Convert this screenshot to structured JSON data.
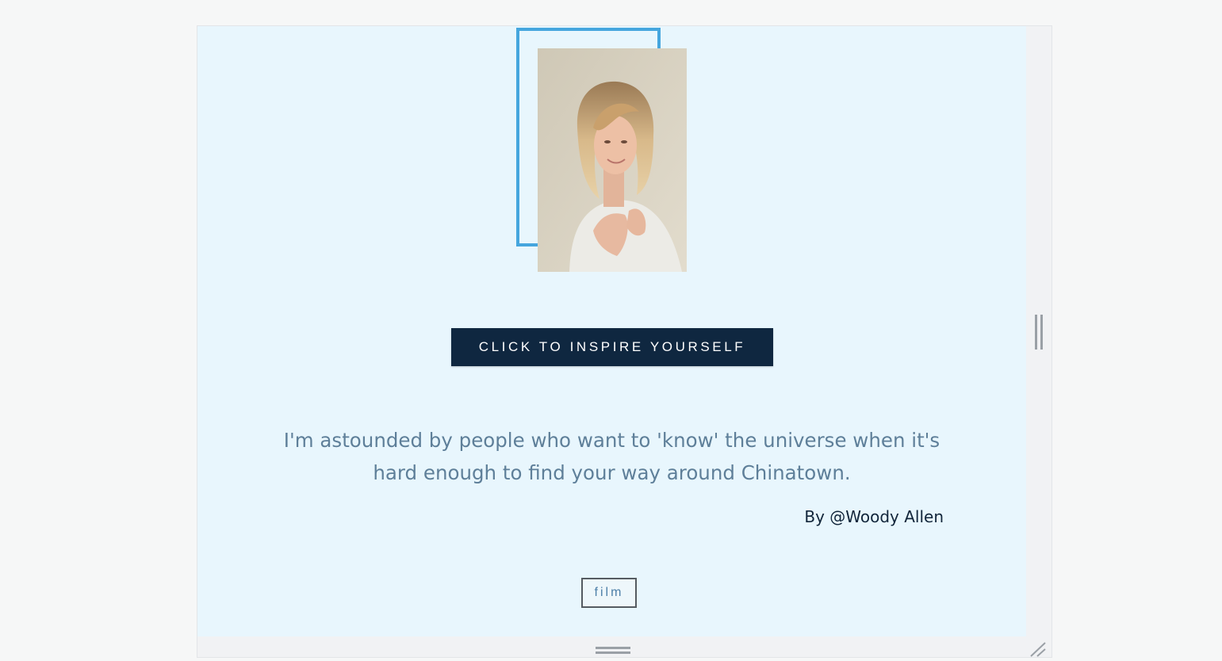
{
  "hero": {
    "photo_alt": "Portrait of a smiling woman with short blonde hair",
    "outline_color": "#45a6de"
  },
  "cta": {
    "label": "CLICK TO INSPIRE YOURSELF",
    "background": "#0f2740"
  },
  "quote": {
    "text": "I'm astounded by people who want to 'know' the universe when it's hard enough to find your way around Chinatown.",
    "author": "By @Woody Allen"
  },
  "tags": [
    {
      "label": "film"
    }
  ],
  "icons": {
    "vertical_resize_grip": "vertical-resize-grip-icon",
    "horizontal_resize_grip": "horizontal-resize-grip-icon",
    "corner_resize_grip": "corner-resize-grip-icon"
  }
}
